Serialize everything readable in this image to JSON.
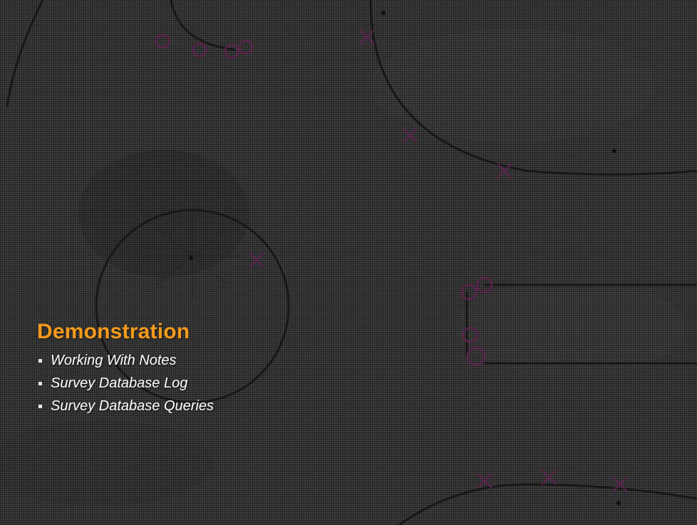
{
  "slide": {
    "title": "Demonstration",
    "bullets": [
      {
        "label": "Working With Notes"
      },
      {
        "label": "Survey Database Log"
      },
      {
        "label": "Survey Database Queries"
      }
    ]
  },
  "colors": {
    "title": "#f39a1c",
    "bullet_text": "#ffffff",
    "bullet_mark": "#e6e6e6",
    "background": "#3c3c3c",
    "sketch_lines": "#1c1c1c",
    "survey_markers": "#7a2a66"
  },
  "icons": {
    "bullet": "square-bullet-icon"
  }
}
